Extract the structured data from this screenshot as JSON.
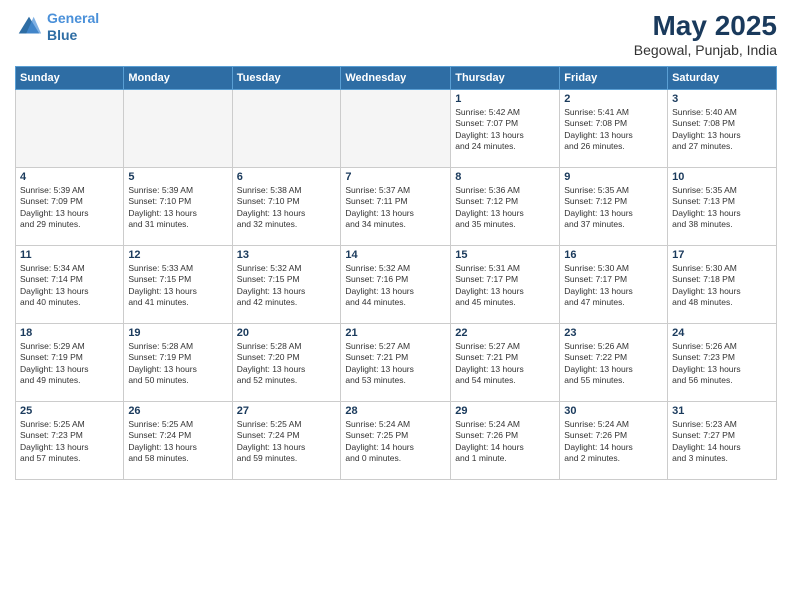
{
  "header": {
    "logo_line1": "General",
    "logo_line2": "Blue",
    "month": "May 2025",
    "location": "Begowal, Punjab, India"
  },
  "weekdays": [
    "Sunday",
    "Monday",
    "Tuesday",
    "Wednesday",
    "Thursday",
    "Friday",
    "Saturday"
  ],
  "weeks": [
    [
      {
        "day": "",
        "info": "",
        "empty": true
      },
      {
        "day": "",
        "info": "",
        "empty": true
      },
      {
        "day": "",
        "info": "",
        "empty": true
      },
      {
        "day": "",
        "info": "",
        "empty": true
      },
      {
        "day": "1",
        "info": "Sunrise: 5:42 AM\nSunset: 7:07 PM\nDaylight: 13 hours\nand 24 minutes."
      },
      {
        "day": "2",
        "info": "Sunrise: 5:41 AM\nSunset: 7:08 PM\nDaylight: 13 hours\nand 26 minutes."
      },
      {
        "day": "3",
        "info": "Sunrise: 5:40 AM\nSunset: 7:08 PM\nDaylight: 13 hours\nand 27 minutes."
      }
    ],
    [
      {
        "day": "4",
        "info": "Sunrise: 5:39 AM\nSunset: 7:09 PM\nDaylight: 13 hours\nand 29 minutes."
      },
      {
        "day": "5",
        "info": "Sunrise: 5:39 AM\nSunset: 7:10 PM\nDaylight: 13 hours\nand 31 minutes."
      },
      {
        "day": "6",
        "info": "Sunrise: 5:38 AM\nSunset: 7:10 PM\nDaylight: 13 hours\nand 32 minutes."
      },
      {
        "day": "7",
        "info": "Sunrise: 5:37 AM\nSunset: 7:11 PM\nDaylight: 13 hours\nand 34 minutes."
      },
      {
        "day": "8",
        "info": "Sunrise: 5:36 AM\nSunset: 7:12 PM\nDaylight: 13 hours\nand 35 minutes."
      },
      {
        "day": "9",
        "info": "Sunrise: 5:35 AM\nSunset: 7:12 PM\nDaylight: 13 hours\nand 37 minutes."
      },
      {
        "day": "10",
        "info": "Sunrise: 5:35 AM\nSunset: 7:13 PM\nDaylight: 13 hours\nand 38 minutes."
      }
    ],
    [
      {
        "day": "11",
        "info": "Sunrise: 5:34 AM\nSunset: 7:14 PM\nDaylight: 13 hours\nand 40 minutes."
      },
      {
        "day": "12",
        "info": "Sunrise: 5:33 AM\nSunset: 7:15 PM\nDaylight: 13 hours\nand 41 minutes."
      },
      {
        "day": "13",
        "info": "Sunrise: 5:32 AM\nSunset: 7:15 PM\nDaylight: 13 hours\nand 42 minutes."
      },
      {
        "day": "14",
        "info": "Sunrise: 5:32 AM\nSunset: 7:16 PM\nDaylight: 13 hours\nand 44 minutes."
      },
      {
        "day": "15",
        "info": "Sunrise: 5:31 AM\nSunset: 7:17 PM\nDaylight: 13 hours\nand 45 minutes."
      },
      {
        "day": "16",
        "info": "Sunrise: 5:30 AM\nSunset: 7:17 PM\nDaylight: 13 hours\nand 47 minutes."
      },
      {
        "day": "17",
        "info": "Sunrise: 5:30 AM\nSunset: 7:18 PM\nDaylight: 13 hours\nand 48 minutes."
      }
    ],
    [
      {
        "day": "18",
        "info": "Sunrise: 5:29 AM\nSunset: 7:19 PM\nDaylight: 13 hours\nand 49 minutes."
      },
      {
        "day": "19",
        "info": "Sunrise: 5:28 AM\nSunset: 7:19 PM\nDaylight: 13 hours\nand 50 minutes."
      },
      {
        "day": "20",
        "info": "Sunrise: 5:28 AM\nSunset: 7:20 PM\nDaylight: 13 hours\nand 52 minutes."
      },
      {
        "day": "21",
        "info": "Sunrise: 5:27 AM\nSunset: 7:21 PM\nDaylight: 13 hours\nand 53 minutes."
      },
      {
        "day": "22",
        "info": "Sunrise: 5:27 AM\nSunset: 7:21 PM\nDaylight: 13 hours\nand 54 minutes."
      },
      {
        "day": "23",
        "info": "Sunrise: 5:26 AM\nSunset: 7:22 PM\nDaylight: 13 hours\nand 55 minutes."
      },
      {
        "day": "24",
        "info": "Sunrise: 5:26 AM\nSunset: 7:23 PM\nDaylight: 13 hours\nand 56 minutes."
      }
    ],
    [
      {
        "day": "25",
        "info": "Sunrise: 5:25 AM\nSunset: 7:23 PM\nDaylight: 13 hours\nand 57 minutes."
      },
      {
        "day": "26",
        "info": "Sunrise: 5:25 AM\nSunset: 7:24 PM\nDaylight: 13 hours\nand 58 minutes."
      },
      {
        "day": "27",
        "info": "Sunrise: 5:25 AM\nSunset: 7:24 PM\nDaylight: 13 hours\nand 59 minutes."
      },
      {
        "day": "28",
        "info": "Sunrise: 5:24 AM\nSunset: 7:25 PM\nDaylight: 14 hours\nand 0 minutes."
      },
      {
        "day": "29",
        "info": "Sunrise: 5:24 AM\nSunset: 7:26 PM\nDaylight: 14 hours\nand 1 minute."
      },
      {
        "day": "30",
        "info": "Sunrise: 5:24 AM\nSunset: 7:26 PM\nDaylight: 14 hours\nand 2 minutes."
      },
      {
        "day": "31",
        "info": "Sunrise: 5:23 AM\nSunset: 7:27 PM\nDaylight: 14 hours\nand 3 minutes."
      }
    ]
  ]
}
